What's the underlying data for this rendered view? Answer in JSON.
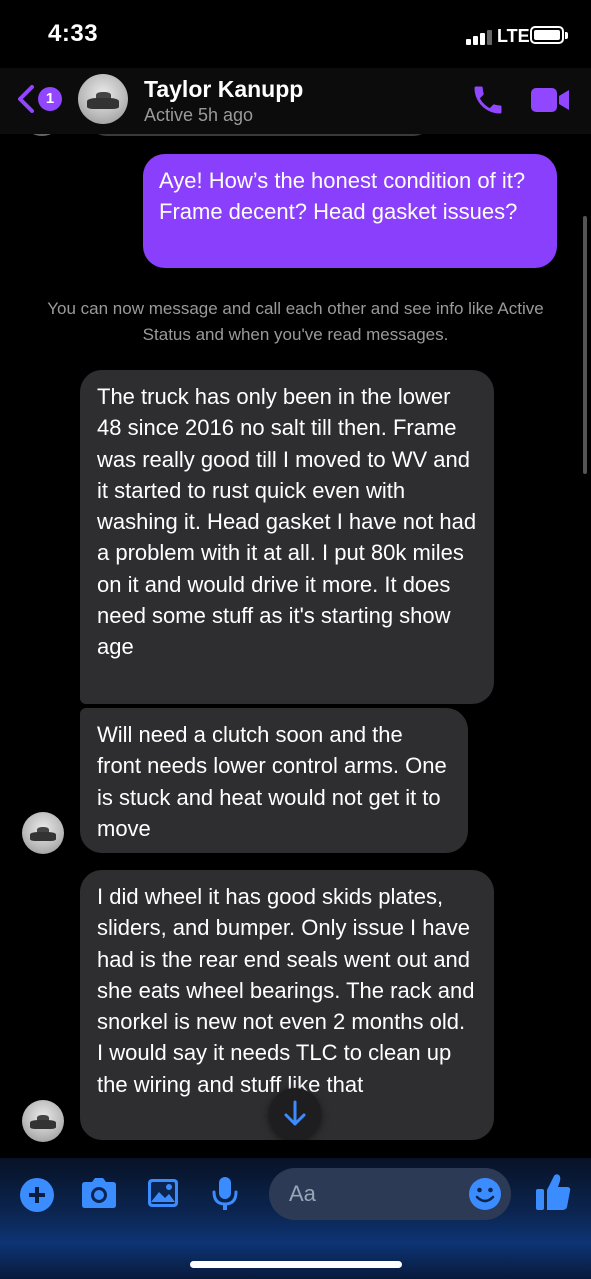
{
  "status_bar": {
    "time": "4:33",
    "network": "LTE"
  },
  "header": {
    "back_badge_count": "1",
    "contact_name": "Taylor Kanupp",
    "contact_status": "Active 5h ago",
    "icons": [
      "back-chevron-icon",
      "avatar",
      "phone-icon",
      "video-camera-icon"
    ],
    "accent_color": "#9146ff"
  },
  "conversation": {
    "outgoing": [
      {
        "text": "Aye! How’s the honest condition of it? Frame decent? Head gasket issues?"
      }
    ],
    "notice": "You can now message and call each other and see info like Active Status and when you've read messages.",
    "incoming": [
      {
        "text": "The truck has only been in the lower 48 since 2016 no salt till then. Frame was really good till I moved to WV and it started to rust quick even with washing it. Head gasket I have not had a problem with it at all. I put 80k miles on it and would drive it more. It does need some stuff as it's starting show age"
      },
      {
        "text": "Will need a clutch soon and the front needs lower control arms. One is stuck and heat would not get it to move"
      },
      {
        "text": "I did wheel it has good skids plates, sliders, and bumper. Only issue I have had is the rear end seals went out and she eats wheel bearings. The rack and snorkel is new not even 2 months old. I would say it needs TLC to clean up the wiring and stuff like that"
      }
    ],
    "outgoing_bubble_color": "#8a3ffc",
    "incoming_bubble_color": "#2e2e30"
  },
  "composer": {
    "placeholder": "Aa",
    "icons": [
      "plus-icon",
      "camera-icon",
      "photo-icon",
      "microphone-icon",
      "emoji-icon",
      "thumbs-up-icon"
    ],
    "icon_color": "#3b8cff"
  }
}
